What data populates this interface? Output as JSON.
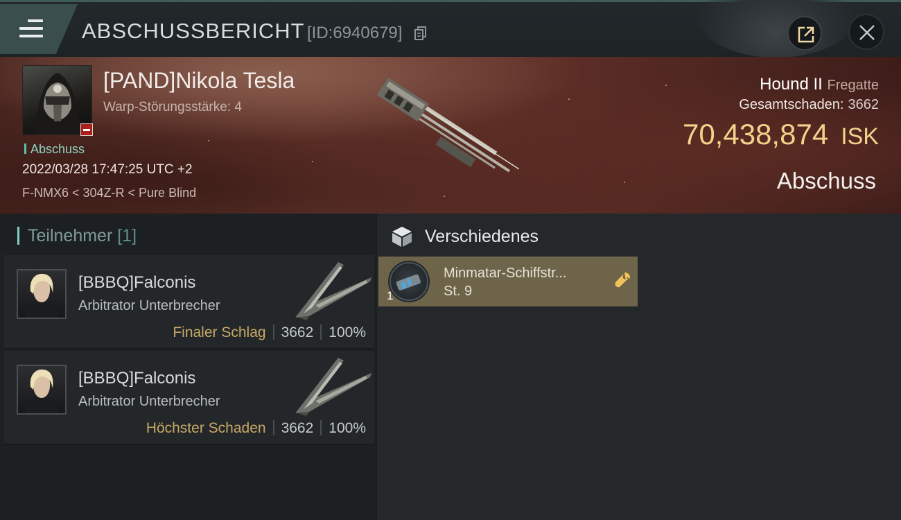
{
  "header": {
    "title": "ABSCHUSSBERICHT",
    "kill_id": "[ID:6940679]"
  },
  "victim": {
    "name": "[PAND]Nikola Tesla",
    "warp_disruption": "Warp-Störungsstärke: 4",
    "status_tag": "Abschuss",
    "datetime": "2022/03/28 17:47:25 UTC +2",
    "location": "F-NMX6 < 304Z-R < Pure Blind",
    "ship_name": "Hound II",
    "ship_class": "Fregatte",
    "damage_label": "Gesamtschaden:",
    "damage_value": "3662",
    "isk_value": "70,438,874",
    "isk_unit": "ISK",
    "result": "Abschuss"
  },
  "participants": {
    "label": "Teilnehmer",
    "count": "[1]",
    "rows": [
      {
        "name": "[BBBQ]Falconis",
        "ship": "Arbitrator Unterbrecher",
        "role": "Finaler Schlag",
        "damage": "3662",
        "percent": "100%"
      },
      {
        "name": "[BBBQ]Falconis",
        "ship": "Arbitrator Unterbrecher",
        "role": "Höchster Schaden",
        "damage": "3662",
        "percent": "100%"
      }
    ]
  },
  "misc": {
    "label": "Verschiedenes",
    "items": [
      {
        "name": "Minmatar-Schiffstr...",
        "level": "St. 9",
        "qty": "1"
      }
    ]
  },
  "colors": {
    "accent_teal": "#7fd0c5",
    "isk_gold": "#f2d28b",
    "role_gold": "#c9a865",
    "loss_red": "#a9201c",
    "item_card": "#6e6449"
  },
  "icons": [
    "menu-icon",
    "copy-icon",
    "share-icon",
    "close-icon",
    "minus-icon",
    "cube-icon",
    "wrench-icon"
  ]
}
